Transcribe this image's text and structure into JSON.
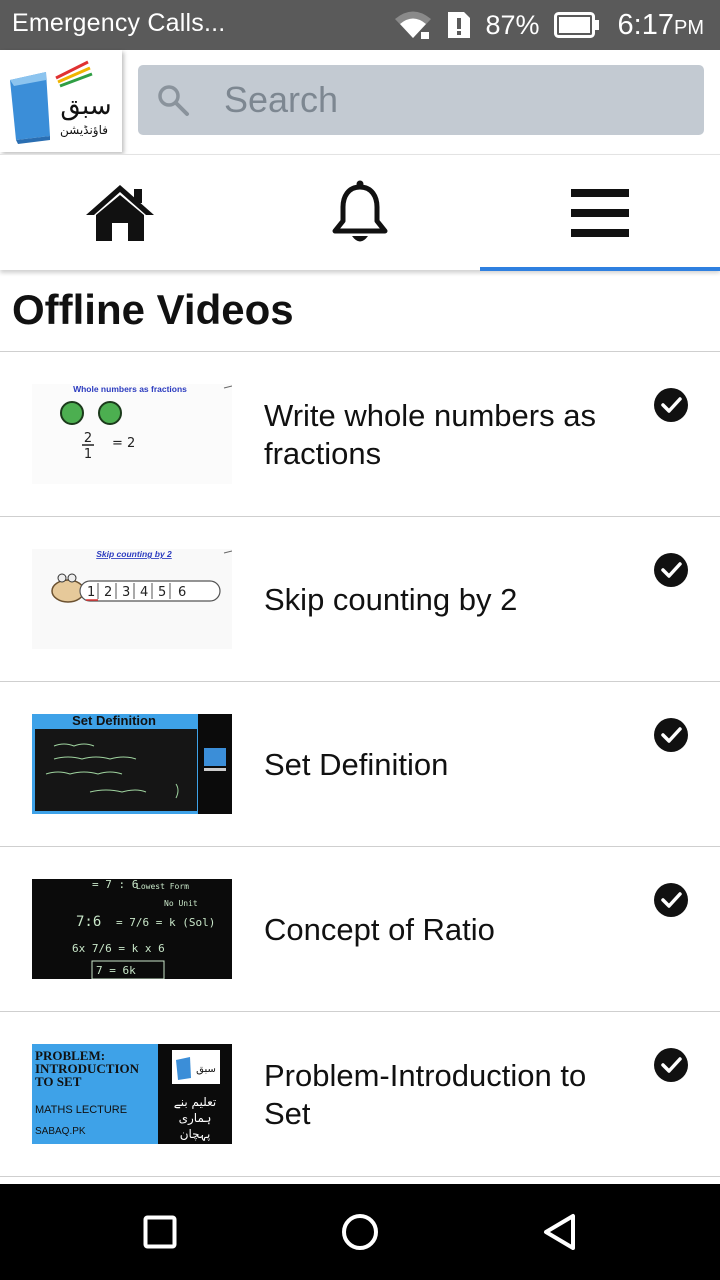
{
  "status_bar": {
    "carrier": "Emergency Calls...",
    "battery_percent": "87%",
    "time": "6:17",
    "ampm": "PM"
  },
  "app_bar": {
    "logo_icon": "sabaq-logo",
    "logo_text": "سبق",
    "logo_subtext": "فاؤنڈیشن",
    "search": {
      "placeholder": "Search",
      "value": ""
    }
  },
  "tabs": [
    {
      "icon": "home-icon",
      "active": false
    },
    {
      "icon": "bell-icon",
      "active": false
    },
    {
      "icon": "menu-icon",
      "active": true
    }
  ],
  "accent_color": "#2f80e0",
  "section_title": "Offline Videos",
  "videos": [
    {
      "title": "Write whole numbers as fractions",
      "thumb_caption": "Whole numbers as fractions",
      "downloaded": true
    },
    {
      "title": "Skip counting by 2",
      "thumb_caption": "Skip counting by 2",
      "thumb_numbers": [
        "1",
        "2",
        "3",
        "4",
        "5",
        "6"
      ],
      "downloaded": true
    },
    {
      "title": "Set Definition",
      "thumb_caption": "Set Definition",
      "downloaded": true
    },
    {
      "title": "Concept of Ratio",
      "thumb_caption": "7:6",
      "downloaded": true
    },
    {
      "title": "Problem-Introduction to Set",
      "thumb_caption": "PROBLEM: INTRODUCTION TO SET",
      "thumb_sub": "MATHS LECTURE",
      "thumb_site": "SABAQ.PK",
      "thumb_urdu": "تعلیم بنے ہماری پہچان",
      "downloaded": true
    }
  ],
  "nav_bar": [
    "square-icon",
    "circle-icon",
    "triangle-back-icon"
  ]
}
